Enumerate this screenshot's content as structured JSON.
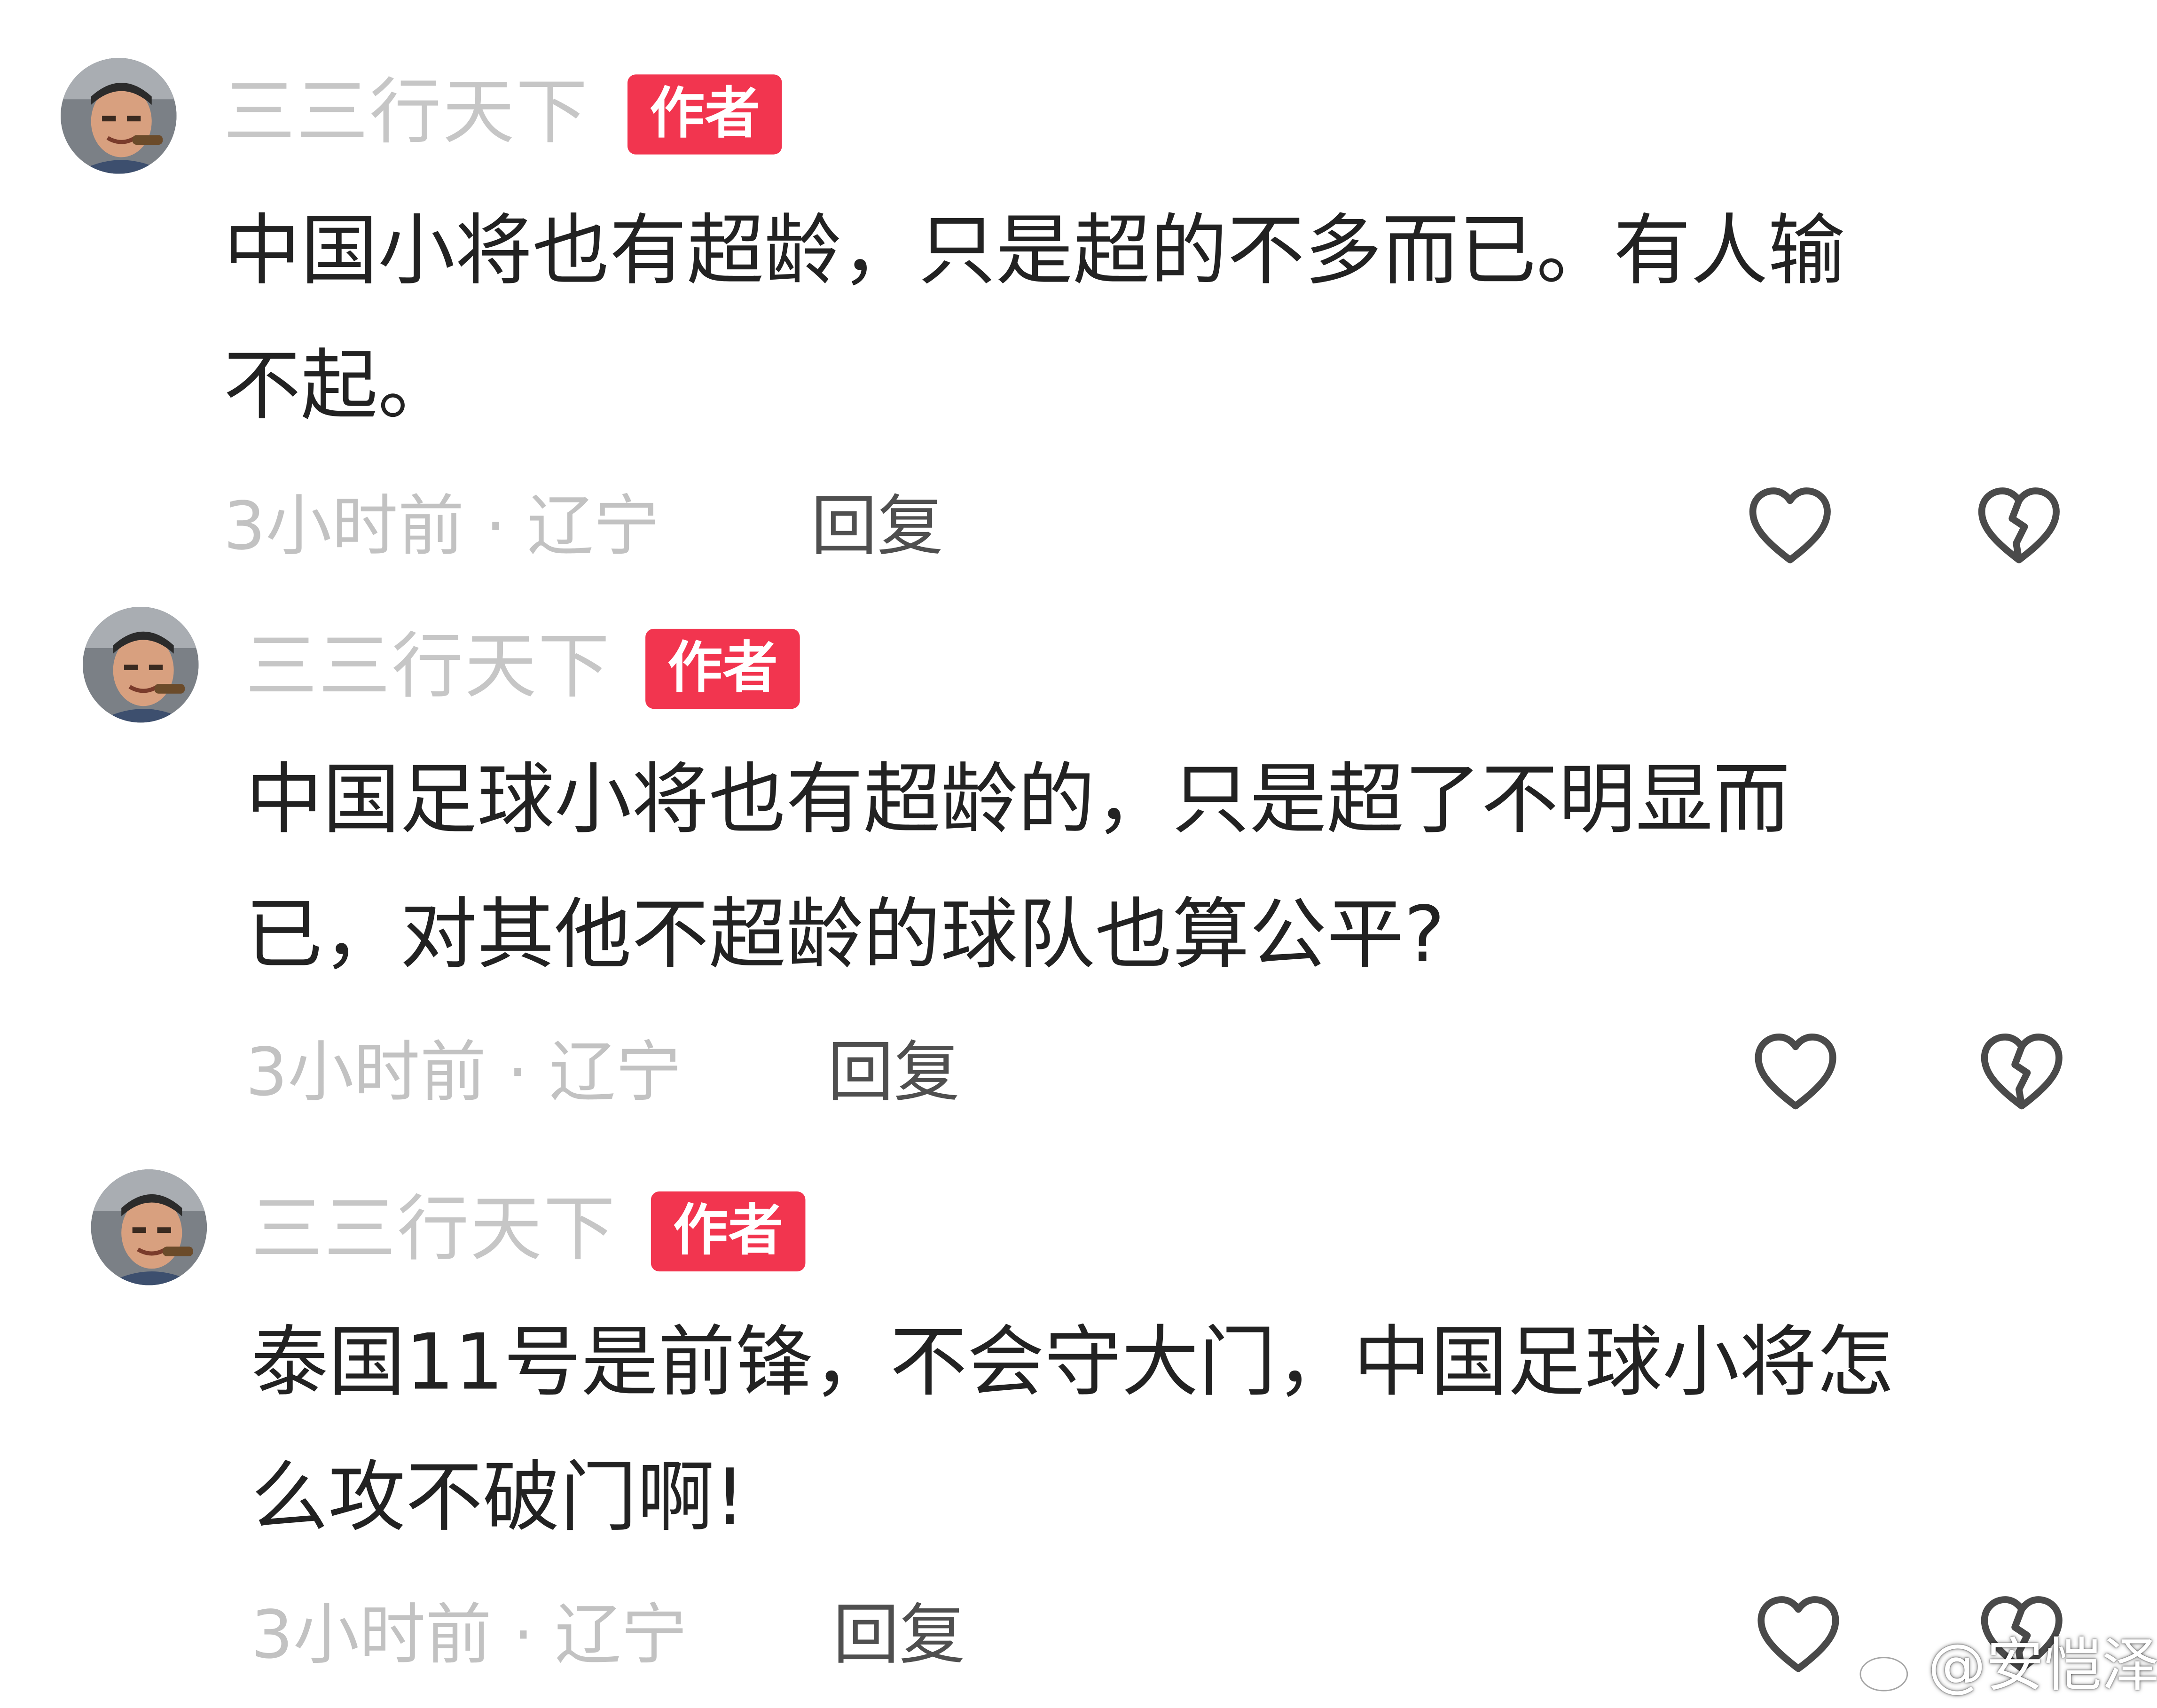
{
  "comments": [
    {
      "author": "三三行天下",
      "badge": "作者",
      "text_line1": "中国小将也有超龄，只是超的不多而已。有人输",
      "text_line2": "不起。",
      "meta": "3小时前 · 辽宁",
      "reply_label": "回复"
    },
    {
      "author": "三三行天下",
      "badge": "作者",
      "text_line1": "中国足球小将也有超龄的，只是超了不明显而",
      "text_line2": "已，对其他不超龄的球队也算公平?",
      "meta": "3小时前 · 辽宁",
      "reply_label": "回复"
    },
    {
      "author": "三三行天下",
      "badge": "作者",
      "text_line1": "泰国11号是前锋，不会守大门，中国足球小将怎",
      "text_line2": "么攻不破门啊!",
      "meta": "3小时前 · 辽宁",
      "reply_label": "回复"
    }
  ],
  "watermark": "@安恺泽",
  "colors": {
    "badge": "#f2354f",
    "author": "#c6c6c6",
    "body_text": "#222222",
    "meta_text": "#c2c2c2",
    "reply_text": "#4f4f4f"
  },
  "icons": [
    "heart-outline-icon",
    "broken-heart-icon",
    "weibo-logo-icon"
  ]
}
